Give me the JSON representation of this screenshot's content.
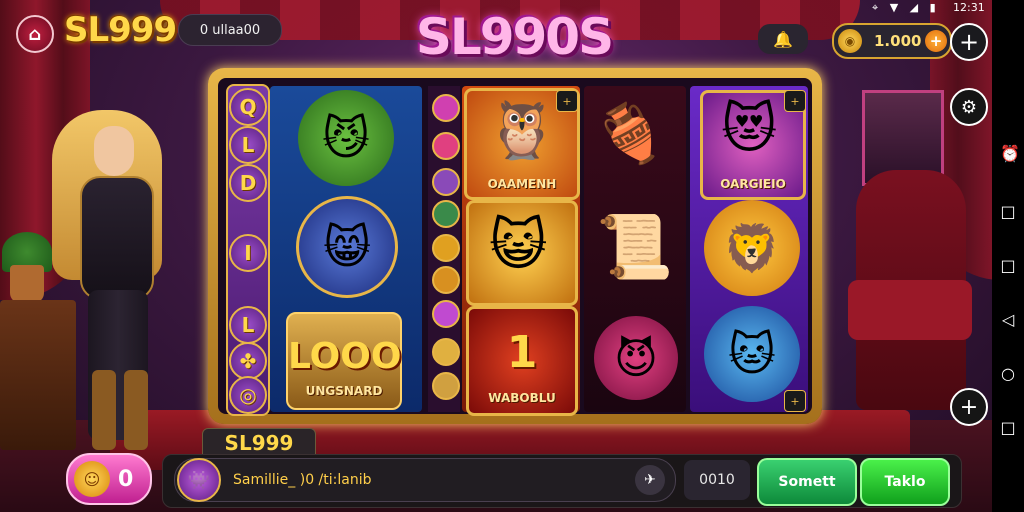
{
  "status_bar": {
    "time": "12:31",
    "icons": "⌖ ▼ ◢ ▮"
  },
  "header": {
    "home_icon": "home-icon",
    "brand": "SL999",
    "promo_label": "0 ullaa00",
    "game_title": "SL990S",
    "bell_icon": "bell-icon",
    "balance_value": "1.000",
    "coin_symbol": "◉",
    "add_symbol": "+",
    "plus_symbol": "+"
  },
  "reels": {
    "left_column_letters": [
      "Q",
      "L",
      "D",
      "I",
      "L",
      "✤",
      "◎"
    ],
    "tiles": {
      "reel2_top_label": "OAAMENH",
      "reel2_bottom_label": "WABOBLU",
      "reel2_bottom_value": "1",
      "reel4_top_label": "OARGIEIO",
      "reel1_bottom_jackpot": "LOOO",
      "reel1_bottom_label": "UNGSNARD"
    }
  },
  "footer": {
    "tab_label": "SL999",
    "coin_count": "0",
    "input_text": "Samillie_ )0 /ti:lanib",
    "bet_value": "0010",
    "submit_label": "Somett",
    "spin_label": "Taklo"
  },
  "nav": {
    "buttons": [
      "◁",
      "○",
      "□"
    ]
  }
}
